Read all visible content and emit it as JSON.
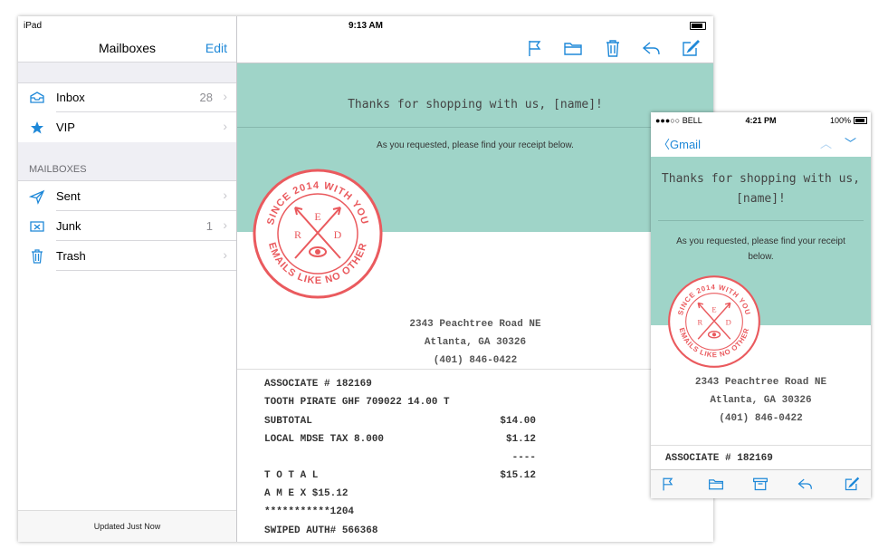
{
  "ipad": {
    "status": {
      "device": "iPad",
      "time": "9:13 AM"
    },
    "sidebar": {
      "title": "Mailboxes",
      "edit_label": "Edit",
      "top_items": [
        {
          "label": "Inbox",
          "count": "28",
          "icon": "inbox-icon"
        },
        {
          "label": "VIP",
          "count": "",
          "icon": "star-icon"
        }
      ],
      "section_label": "MAILBOXES",
      "mailbox_items": [
        {
          "label": "Sent",
          "count": "",
          "icon": "paper-plane-icon"
        },
        {
          "label": "Junk",
          "count": "1",
          "icon": "junk-icon"
        },
        {
          "label": "Trash",
          "count": "",
          "icon": "trash-icon"
        }
      ],
      "footer": "Updated Just Now"
    },
    "toolbar": [
      "flag-icon",
      "folder-icon",
      "trash-icon",
      "reply-icon",
      "compose-icon"
    ],
    "email": {
      "heading": "Thanks for shopping with us, [name]!",
      "subtext": "As you requested, please find your receipt below.",
      "stamp": {
        "top_text": "SINCE 2014 WITH YOU",
        "bottom_text": "EMAILS LIKE NO OTHER",
        "letters": [
          "R",
          "E",
          "D"
        ]
      },
      "address": [
        "2343 Peachtree Road NE",
        "Atlanta, GA 30326",
        "(401) 846-0422"
      ],
      "receipt": [
        {
          "label": "ASSOCIATE # 182169",
          "value": ""
        },
        {
          "label": "TOOTH PIRATE GHF 709022 14.00 T",
          "value": ""
        },
        {
          "label": "SUBTOTAL",
          "value": "$14.00"
        },
        {
          "label": "LOCAL MDSE TAX 8.000",
          "value": "$1.12"
        },
        {
          "label": "",
          "value": "----"
        },
        {
          "label": "T O T A L",
          "value": "$15.12"
        },
        {
          "label": "A M E X $15.12",
          "value": ""
        },
        {
          "label": "***********1204",
          "value": ""
        },
        {
          "label": "SWIPED AUTH# 566368",
          "value": ""
        }
      ]
    }
  },
  "iphone": {
    "status": {
      "carrier": "BELL",
      "time": "4:21 PM",
      "battery": "100%"
    },
    "nav": {
      "back_label": "Gmail"
    },
    "email": {
      "heading": "Thanks for shopping with us, [name]!",
      "subtext": "As you requested, please find your receipt below.",
      "address": [
        "2343 Peachtree Road NE",
        "Atlanta, GA 30326",
        "(401) 846-0422"
      ],
      "receipt_first": "ASSOCIATE # 182169"
    },
    "tabbar": [
      "flag-icon",
      "folder-icon",
      "archive-icon",
      "reply-icon",
      "compose-icon"
    ]
  },
  "colors": {
    "accent": "#1e88d8",
    "hero_bg": "#9fd4c8",
    "stamp": "#ea5a5e"
  }
}
